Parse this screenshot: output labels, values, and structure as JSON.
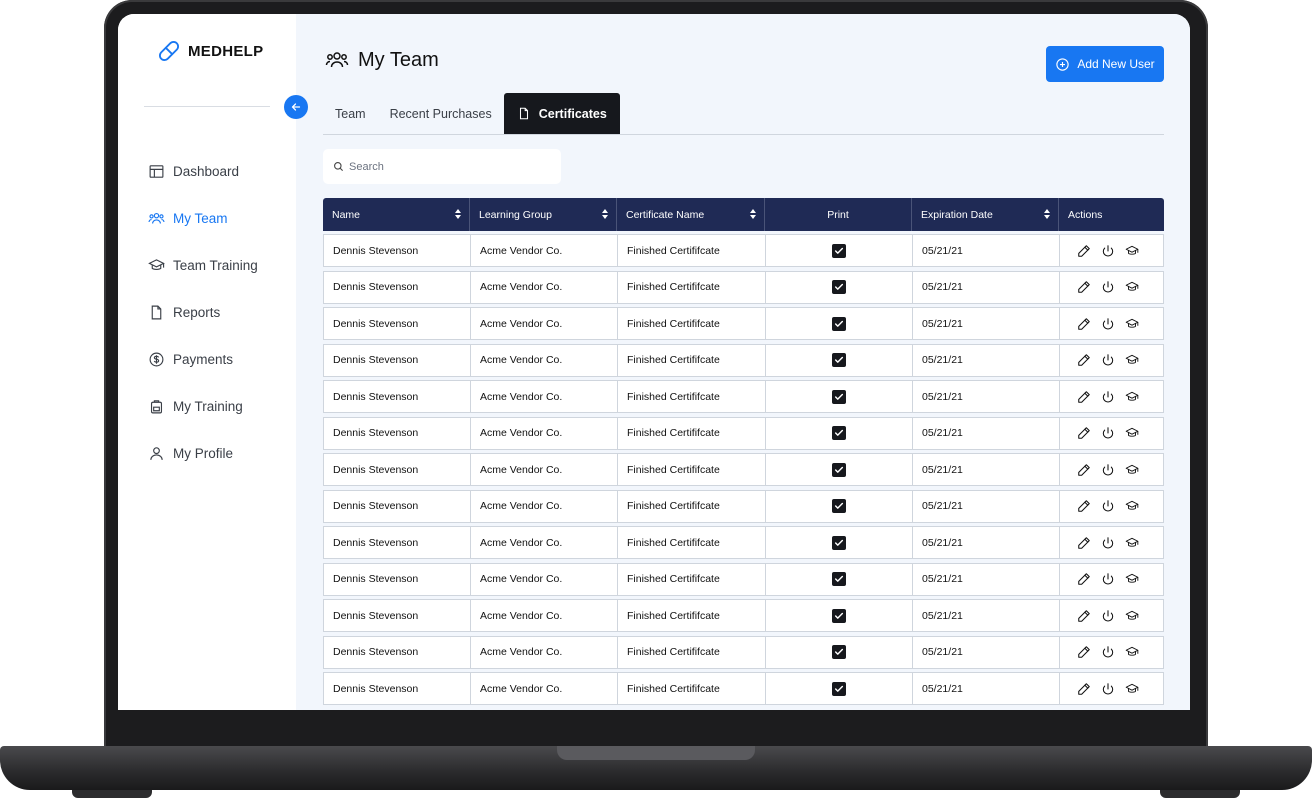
{
  "app": {
    "brand": "MEDHELP"
  },
  "sidebar": {
    "items": [
      {
        "label": "Dashboard",
        "icon": "layout-icon",
        "active": false
      },
      {
        "label": "My Team",
        "icon": "users-icon",
        "active": true
      },
      {
        "label": "Team Training",
        "icon": "graduation-cap-icon",
        "active": false
      },
      {
        "label": "Reports",
        "icon": "file-icon",
        "active": false
      },
      {
        "label": "Payments",
        "icon": "dollar-circle-icon",
        "active": false
      },
      {
        "label": "My Training",
        "icon": "backpack-icon",
        "active": false
      },
      {
        "label": "My Profile",
        "icon": "user-icon",
        "active": false
      }
    ]
  },
  "header": {
    "title": "My Team",
    "add_button": "Add New User"
  },
  "tabs": [
    {
      "label": "Team",
      "active": false
    },
    {
      "label": "Recent Purchases",
      "active": false
    },
    {
      "label": "Certificates",
      "active": true
    }
  ],
  "search": {
    "placeholder": "Search",
    "value": ""
  },
  "table": {
    "columns": [
      "Name",
      "Learning Group",
      "Certificate Name",
      "Print",
      "Expiration Date",
      "Actions"
    ],
    "rows": [
      {
        "name": "Dennis Stevenson",
        "group": "Acme Vendor Co.",
        "certificate": "Finished Certififcate",
        "print": true,
        "expiration": "05/21/21"
      },
      {
        "name": "Dennis Stevenson",
        "group": "Acme Vendor Co.",
        "certificate": "Finished Certififcate",
        "print": true,
        "expiration": "05/21/21"
      },
      {
        "name": "Dennis Stevenson",
        "group": "Acme Vendor Co.",
        "certificate": "Finished Certififcate",
        "print": true,
        "expiration": "05/21/21"
      },
      {
        "name": "Dennis Stevenson",
        "group": "Acme Vendor Co.",
        "certificate": "Finished Certififcate",
        "print": true,
        "expiration": "05/21/21"
      },
      {
        "name": "Dennis Stevenson",
        "group": "Acme Vendor Co.",
        "certificate": "Finished Certififcate",
        "print": true,
        "expiration": "05/21/21"
      },
      {
        "name": "Dennis Stevenson",
        "group": "Acme Vendor Co.",
        "certificate": "Finished Certififcate",
        "print": true,
        "expiration": "05/21/21"
      },
      {
        "name": "Dennis Stevenson",
        "group": "Acme Vendor Co.",
        "certificate": "Finished Certififcate",
        "print": true,
        "expiration": "05/21/21"
      },
      {
        "name": "Dennis Stevenson",
        "group": "Acme Vendor Co.",
        "certificate": "Finished Certififcate",
        "print": true,
        "expiration": "05/21/21"
      },
      {
        "name": "Dennis Stevenson",
        "group": "Acme Vendor Co.",
        "certificate": "Finished Certififcate",
        "print": true,
        "expiration": "05/21/21"
      },
      {
        "name": "Dennis Stevenson",
        "group": "Acme Vendor Co.",
        "certificate": "Finished Certififcate",
        "print": true,
        "expiration": "05/21/21"
      },
      {
        "name": "Dennis Stevenson",
        "group": "Acme Vendor Co.",
        "certificate": "Finished Certififcate",
        "print": true,
        "expiration": "05/21/21"
      },
      {
        "name": "Dennis Stevenson",
        "group": "Acme Vendor Co.",
        "certificate": "Finished Certififcate",
        "print": true,
        "expiration": "05/21/21"
      },
      {
        "name": "Dennis Stevenson",
        "group": "Acme Vendor Co.",
        "certificate": "Finished Certififcate",
        "print": true,
        "expiration": "05/21/21"
      }
    ],
    "row_actions": [
      "pencil-icon",
      "power-icon",
      "graduation-cap-icon"
    ]
  },
  "colors": {
    "accent": "#1877f2",
    "table_header": "#1f2a55",
    "active_tab": "#16181d",
    "main_bg": "#f2f6fc"
  }
}
